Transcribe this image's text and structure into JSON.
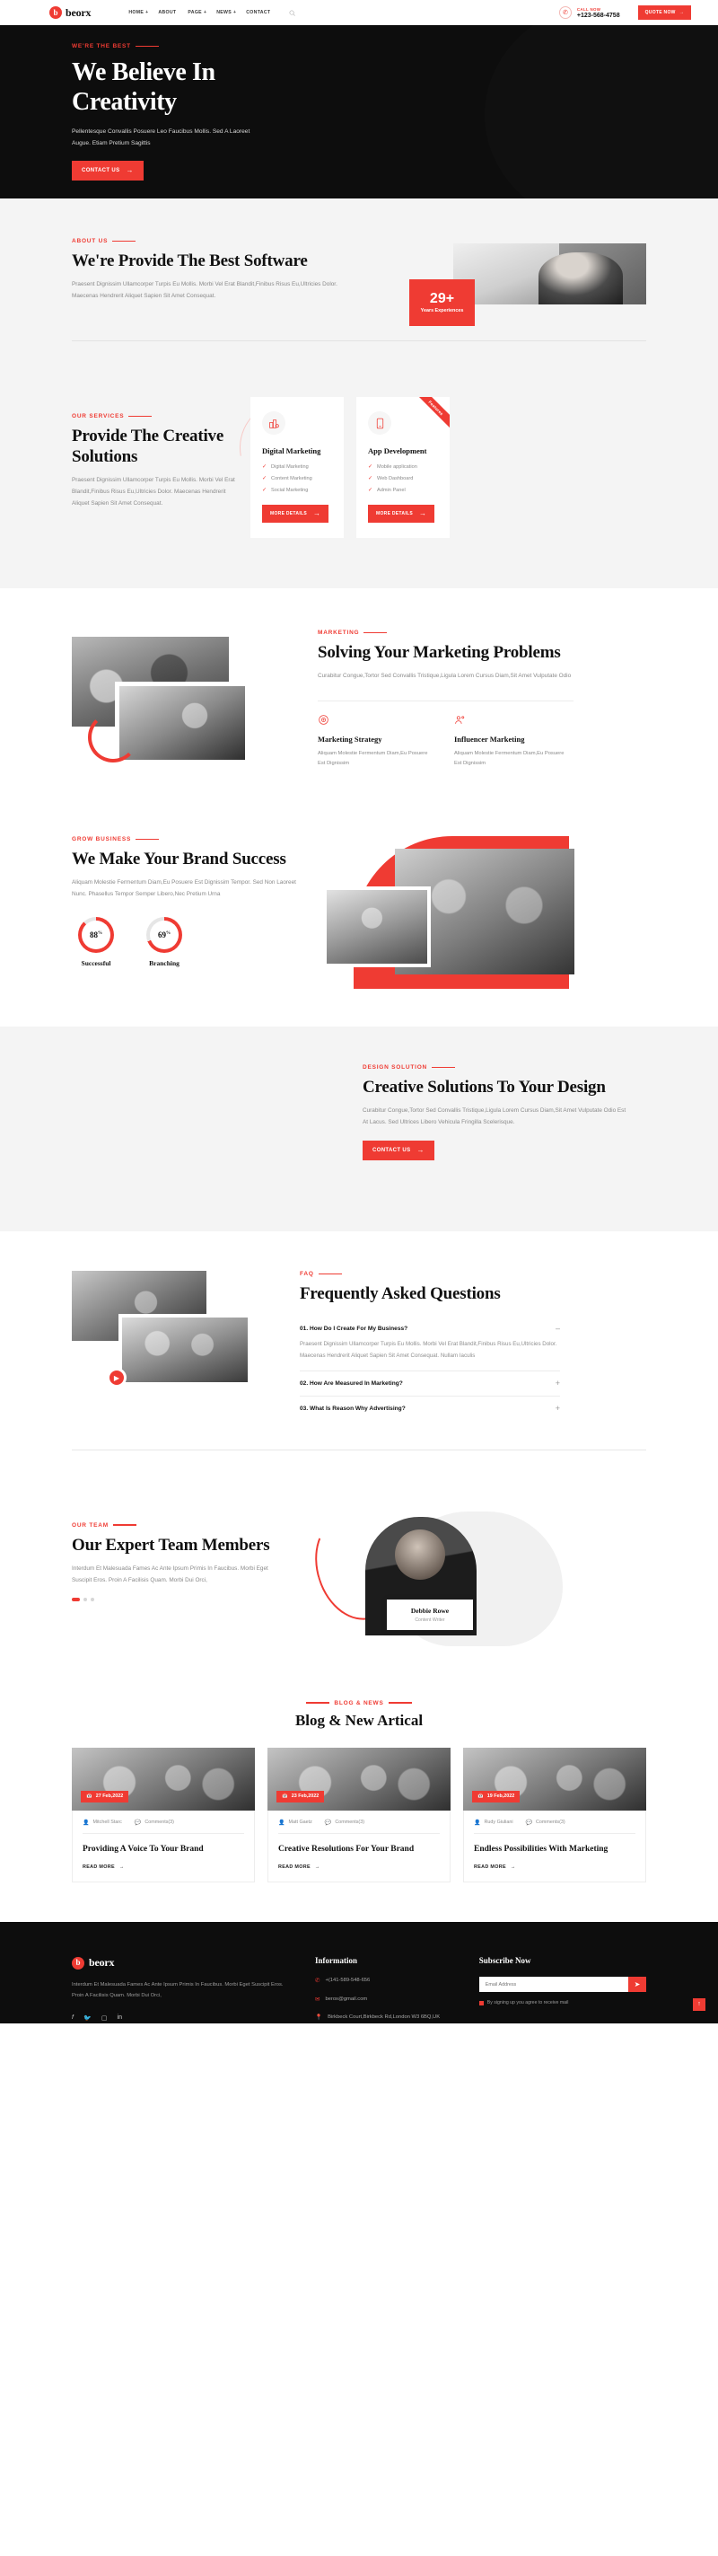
{
  "brand": {
    "mark": "b",
    "name": "beorx"
  },
  "header": {
    "nav": [
      {
        "label": "HOME",
        "caret": "+"
      },
      {
        "label": "ABOUT",
        "caret": ""
      },
      {
        "label": "PAGE",
        "caret": "+"
      },
      {
        "label": "NEWS",
        "caret": "+"
      },
      {
        "label": "CONTACT",
        "caret": ""
      }
    ],
    "call_label": "CALL NOW",
    "call_number": "+123-568-4758",
    "cta": "QUOTE NOW"
  },
  "hero": {
    "eyebrow": "WE'RE THE BEST",
    "title_line1": "We Believe In",
    "title_line2": "Creativity",
    "paragraph": "Pellentesque Convallis Posuere Leo Faucibus Mollis. Sed A Laoreet Augue. Etiam Pretium Sagittis",
    "cta": "CONTACT US"
  },
  "about": {
    "eyebrow": "ABOUT US",
    "title": "We're Provide The Best Software",
    "paragraph": "Praesent Dignissim Ullamcorper Turpis Eu Mollis. Morbi Vel Erat Blandit,Finibus Risus Eu,Ultricies Dolor. Maecenas Hendrerit Aliquet Sapien Sit Amet Consequat.",
    "badge_number": "29+",
    "badge_label": "Years Experiences"
  },
  "services": {
    "eyebrow": "OUR SERVICES",
    "title": "Provide The Creative Solutions",
    "paragraph": "Praesent Dignissim Ullamcorper Turpis Eu Mollis. Morbi Vel Erat Blandit,Finibus Risus Eu,Ultricies Dolor. Maecenas Hendrerit Aliquet Sapien Sit Amet Consequat.",
    "ribbon": "Features",
    "cards": [
      {
        "title": "Digital Marketing",
        "items": [
          "Digital Marketing",
          "Content Marketing",
          "Social Marketing"
        ],
        "cta": "MORE DETAILS"
      },
      {
        "title": "App Development",
        "items": [
          "Mobile application",
          "Web Dashboard",
          "Admin Panel"
        ],
        "cta": "MORE DETAILS"
      }
    ]
  },
  "marketing": {
    "eyebrow": "MARKETING",
    "title": "Solving Your Marketing Problems",
    "paragraph": "Curabitur Congue,Tortor Sed Convallis Tristique,Ligula Lorem Cursus Diam,Sit Amet Vulputate Odio",
    "columns": [
      {
        "title": "Marketing Strategy",
        "text": "Aliquam Molestie Fermentum Diam,Eu Posuere Est Dignissim"
      },
      {
        "title": "Influencer Marketing",
        "text": "Aliquam Molestie Fermentum Diam,Eu Posuere Est Dignissim"
      }
    ]
  },
  "grow": {
    "eyebrow": "GROW BUSINESS",
    "title": "We Make Your Brand Success",
    "paragraph": "Aliquam Molestie Fermentum Diam,Eu Posuere Est Dignissim Tempor. Sed Non Laoreet Nunc. Phasellus Tempor Semper Libero,Nec Pretium Urna",
    "dials": [
      {
        "value": "88",
        "unit": "%",
        "label": "Successful",
        "percent": 88
      },
      {
        "value": "69",
        "unit": "%",
        "label": "Branching",
        "percent": 69
      }
    ]
  },
  "design": {
    "eyebrow": "DESIGN SOLUTION",
    "title": "Creative Solutions To Your Design",
    "paragraph": "Curabitur Congue,Tortor Sed Convallis Tristique,Ligula Lorem Cursus Diam,Sit Amet Vulputate Odio Est At Lacus. Sed Ultrices Libero Vehicula Fringilla Scelerisque.",
    "cta": "CONTACT US"
  },
  "faq": {
    "eyebrow": "FAQ",
    "title": "Frequently Asked Questions",
    "items": [
      {
        "question": "01. How Do I Create For My Business?",
        "sign": "–",
        "answer": "Praesent Dignissim Ullamcorper Turpis Eu Mollis. Morbi Vel Erat Blandit,Finibus Risus Eu,Ultricies Dolor. Maecenas Hendrerit Aliquet Sapien Sit Amet Consequat. Nullam Iaculis"
      },
      {
        "question": "02. How Are Measured In Marketing?",
        "sign": "+",
        "answer": ""
      },
      {
        "question": "03. What Is Reason Why Advertising?",
        "sign": "+",
        "answer": ""
      }
    ]
  },
  "team": {
    "eyebrow": "OUR TEAM",
    "title": "Our Expert Team Members",
    "paragraph": "Interdum Et Malesuada Fames Ac Ante Ipsum Primis In Faucibus. Morbi Eget Suscipit Eros. Proin A Facilisis Quam. Morbi Dui Orci,",
    "member_name": "Debbie Rowe",
    "member_role": "Content Writer"
  },
  "blog": {
    "eyebrow": "BLOG & NEWS",
    "title": "Blog & New Artical",
    "posts": [
      {
        "date": "27 Feb,2022",
        "author": "Mitchell Starc",
        "comments": "Comments(3)",
        "title": "Providing A Voice To Your Brand",
        "more": "READ MORE"
      },
      {
        "date": "23 Feb,2022",
        "author": "Matt Gaetz",
        "comments": "Comments(3)",
        "title": "Creative Resolutions For Your Brand",
        "more": "READ MORE"
      },
      {
        "date": "19 Feb,2022",
        "author": "Rudy Giuliani",
        "comments": "Comments(3)",
        "title": "Endless Possibilities With Marketing",
        "more": "READ MORE"
      }
    ]
  },
  "footer": {
    "about_text": "Interdum Et Malesuada Fames Ac Ante Ipsum Primis In Faucibus. Morbi Eget Suscipit Eros. Proin A Facilisis Quam. Morbi Dui Orci,",
    "info_heading": "Information",
    "info": [
      {
        "icon": "phone-icon",
        "text": "+(141-589-548-656"
      },
      {
        "icon": "mail-icon",
        "text": "berox@gmail.com"
      },
      {
        "icon": "pin-icon",
        "text": "Birkbeck Court,Birkbeck Rd,London W3 6BQ,UK"
      }
    ],
    "subscribe_heading": "Subscribe Now",
    "email_placeholder": "Email Address",
    "agree_text": "By signing up you agree to receive mail",
    "socials": [
      "facebook-icon",
      "twitter-icon",
      "instagram-icon",
      "linkedin-icon"
    ]
  }
}
